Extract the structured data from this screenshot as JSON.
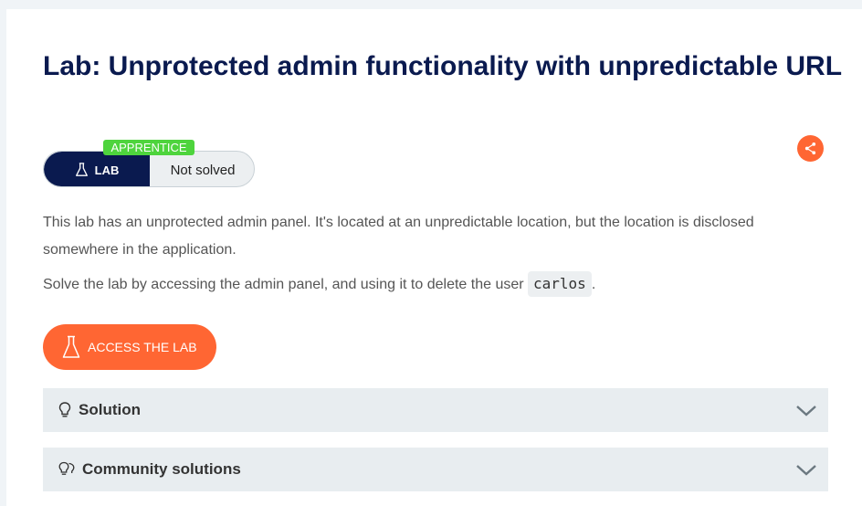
{
  "title": "Lab: Unprotected admin functionality with unpredictable URL",
  "badge": {
    "lab_label": "LAB",
    "level": "APPRENTICE",
    "status": "Not solved"
  },
  "description": {
    "line1": "This lab has an unprotected admin panel. It's located at an unpredictable location, but the location is disclosed somewhere in the application.",
    "line2_prefix": "Solve the lab by accessing the admin panel, and using it to delete the user",
    "line2_code": "carlos",
    "line2_suffix": "."
  },
  "access_button": {
    "label": "ACCESS THE LAB"
  },
  "accordions": [
    {
      "label": "Solution",
      "icon": "lightbulb-icon"
    },
    {
      "label": "Community solutions",
      "icon": "lightbulbs-icon"
    }
  ],
  "colors": {
    "title": "#0a1a4f",
    "accent": "#ff6633",
    "level_badge": "#4ed43d",
    "accordion_bg": "#e8edf0"
  }
}
